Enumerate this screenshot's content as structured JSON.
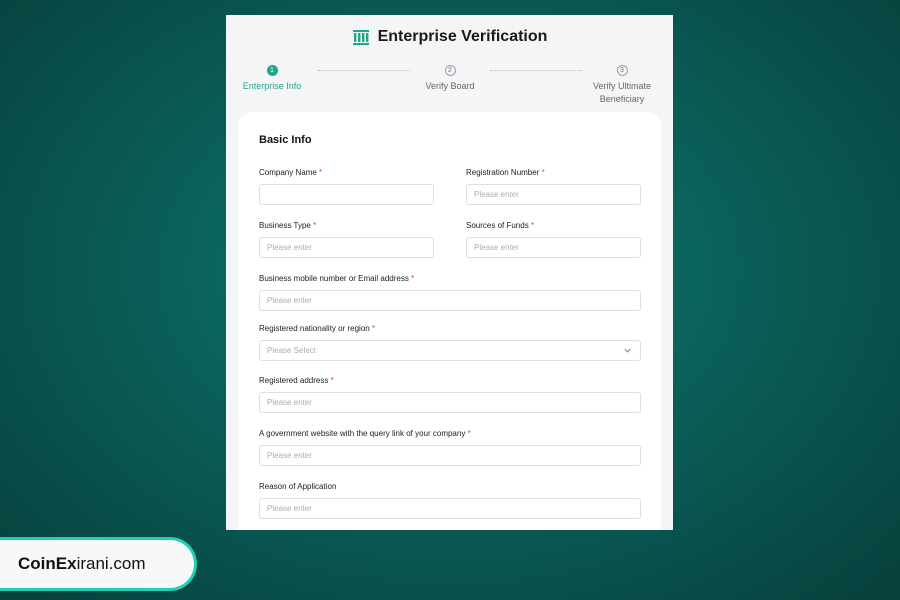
{
  "header": {
    "title": "Enterprise Verification",
    "icon": "bank-icon"
  },
  "steps": [
    {
      "number": "1",
      "label": "Enterprise Info",
      "state": "active"
    },
    {
      "number": "2",
      "label": "Verify Board",
      "state": "inactive"
    },
    {
      "number": "3",
      "label": "Verify Ultimate Beneficiary",
      "state": "inactive"
    }
  ],
  "form": {
    "section_title": "Basic Info",
    "fields": {
      "company_name": {
        "label": "Company Name",
        "required": "*",
        "placeholder": ""
      },
      "registration_number": {
        "label": "Registration Number",
        "required": "*",
        "placeholder": "Please enter"
      },
      "business_type": {
        "label": "Business Type",
        "required": "*",
        "placeholder": "Please enter"
      },
      "sources_of_funds": {
        "label": "Sources of Funds",
        "required": "*",
        "placeholder": "Please enter"
      },
      "contact": {
        "label": "Business mobile number or Email address",
        "required": "*",
        "placeholder": "Please enter"
      },
      "nationality": {
        "label": "Registered nationality or region",
        "required": "*",
        "placeholder": "Please Select"
      },
      "address": {
        "label": "Registered address",
        "required": "*",
        "placeholder": "Please enter"
      },
      "gov_website": {
        "label": "A government website with the query link of your company",
        "required": "*",
        "placeholder": "Please enter"
      },
      "reason": {
        "label": "Reason of Application",
        "placeholder": "Please enter"
      }
    }
  },
  "brand": {
    "bold": "CoinEx",
    "regular": "irani.com"
  },
  "colors": {
    "accent": "#20a58f",
    "required": "#e23b3b",
    "background": "#0a5f58",
    "brand_border": "#1fd0b8"
  }
}
